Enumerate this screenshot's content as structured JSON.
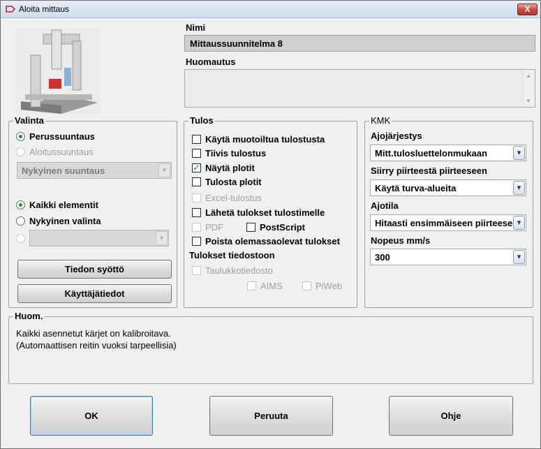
{
  "window": {
    "title": "Aloita mittaus",
    "close_label": "X"
  },
  "header": {
    "name_label": "Nimi",
    "name_value": "Mittaussuunnitelma 8",
    "note_label": "Huomautus",
    "note_value": ""
  },
  "valinta": {
    "title": "Valinta",
    "perussuuntaus": "Perussuuntaus",
    "aloitussuuntaus": "Aloitussuuntaus",
    "alignment_select": "Nykyinen suuntaus",
    "kaikki_elementit": "Kaikki elementit",
    "nykyinen_valinta": "Nykyinen valinta",
    "empty_select": "",
    "tiedon_syotto": "Tiedon syöttö",
    "kayttajatiedot": "Käyttäjätiedot"
  },
  "tulos": {
    "title": "Tulos",
    "items": [
      {
        "label": "Käytä muotoiltua tulostusta",
        "checked": false,
        "enabled": true
      },
      {
        "label": "Tiivis tulostus",
        "checked": false,
        "enabled": true
      },
      {
        "label": "Näytä plotit",
        "checked": true,
        "enabled": true
      },
      {
        "label": "Tulosta plotit",
        "checked": false,
        "enabled": true
      },
      {
        "label": "Excel-tulostus",
        "checked": false,
        "enabled": false
      },
      {
        "label": "Lähetä tulokset tulostimelle",
        "checked": false,
        "enabled": true
      },
      {
        "label": "PDF",
        "checked": false,
        "enabled": false
      },
      {
        "label": "PostScript",
        "checked": false,
        "enabled": true
      },
      {
        "label": "Poista olemassaolevat tulokset",
        "checked": false,
        "enabled": true
      }
    ],
    "file_section_label": "Tulokset tiedostoon",
    "taulukkotiedosto": "Taulukkotiedosto",
    "aims": "AIMS",
    "piweb": "PiWeb"
  },
  "kmk": {
    "title": "KMK",
    "run_order_label": "Ajojärjestys",
    "run_order_value": "Mitt.tulosluettelonmukaan",
    "move_label": "Siirry piirteestä piirteeseen",
    "move_value": "Käytä turva-alueita",
    "mode_label": "Ajotila",
    "mode_value": "Hitaasti ensimmäiseen piirteeseen",
    "speed_label": "Nopeus mm/s",
    "speed_value": "300"
  },
  "huom": {
    "title": "Huom.",
    "line1": "Kaikki asennetut kärjet on kalibroitava.",
    "line2": "(Automaattisen reitin vuoksi tarpeellisia)"
  },
  "footer": {
    "ok": "OK",
    "cancel": "Peruuta",
    "help": "Ohje"
  },
  "colors": {
    "title_bar": "#cfdcee",
    "close_button": "#c7463a",
    "name_field_bg": "#cfcfcf",
    "radio_dot": "#1a9c1a",
    "check_mark": "#1e7c1e"
  }
}
